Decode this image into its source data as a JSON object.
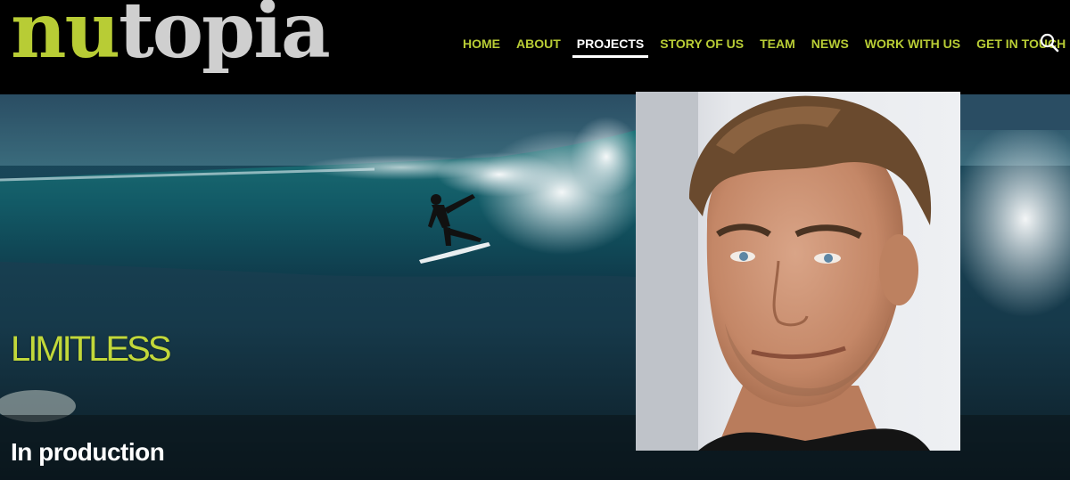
{
  "brand": {
    "logo_part_a": "nu",
    "logo_part_b": "topia"
  },
  "nav": {
    "items": [
      {
        "label": "HOME"
      },
      {
        "label": "ABOUT"
      },
      {
        "label": "PROJECTS",
        "active": true
      },
      {
        "label": "STORY OF US"
      },
      {
        "label": "TEAM"
      },
      {
        "label": "NEWS"
      },
      {
        "label": "WORK WITH US"
      },
      {
        "label": "GET IN TOUCH"
      }
    ],
    "search_icon": "search-icon"
  },
  "hero": {
    "title": "LIMITLESS",
    "status": "In production",
    "background_image": "surfer-wave-image",
    "portrait_image": "man-portrait-image"
  },
  "colors": {
    "accent": "#b8cc35",
    "logo_grey": "#cfcfcf",
    "header_bg": "#000000",
    "active_nav": "#ffffff"
  }
}
